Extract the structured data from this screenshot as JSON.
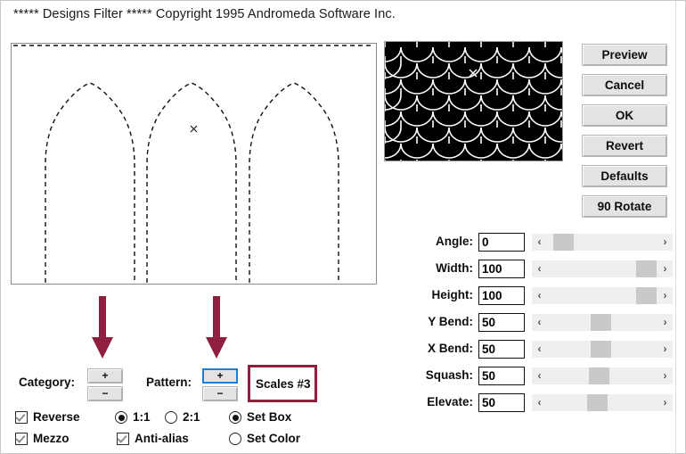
{
  "window": {
    "title": "***** Designs Filter *****  Copyright 1995 Andromeda Software Inc."
  },
  "preview_canvas": {
    "name": "shape-preview",
    "marker": "×",
    "description": "three dashed gothic arch outlines"
  },
  "pattern_thumbnail": {
    "name": "pattern-preview",
    "background_color": "#000000",
    "line_color": "#ffffff",
    "center_marker": "×"
  },
  "buttons": [
    {
      "label": "Preview",
      "name": "preview-button"
    },
    {
      "label": "Cancel",
      "name": "cancel-button"
    },
    {
      "label": "OK",
      "name": "ok-button"
    },
    {
      "label": "Revert",
      "name": "revert-button"
    },
    {
      "label": "Defaults",
      "name": "defaults-button"
    },
    {
      "label": "90 Rotate",
      "name": "rotate-90-button"
    }
  ],
  "sliders": [
    {
      "label": "Angle:",
      "value": "0",
      "percent": 4,
      "name": "angle"
    },
    {
      "label": "Width:",
      "value": "100",
      "percent": 88,
      "name": "width"
    },
    {
      "label": "Height:",
      "value": "100",
      "percent": 88,
      "name": "height"
    },
    {
      "label": "Y Bend:",
      "value": "50",
      "percent": 47,
      "name": "y-bend"
    },
    {
      "label": "X Bend:",
      "value": "50",
      "percent": 47,
      "name": "x-bend"
    },
    {
      "label": "Squash:",
      "value": "50",
      "percent": 46,
      "name": "squash"
    },
    {
      "label": "Elevate:",
      "value": "50",
      "percent": 45,
      "name": "elevate"
    }
  ],
  "slider_arrows": {
    "left": "‹",
    "right": "›"
  },
  "category": {
    "label": "Category:",
    "increment_label": "+",
    "decrement_label": "−"
  },
  "pattern": {
    "label": "Pattern:",
    "increment_label": "+",
    "decrement_label": "−",
    "selected_name": "Scales #3"
  },
  "options": {
    "reverse": {
      "label": "Reverse",
      "checked": true
    },
    "mezzo": {
      "label": "Mezzo",
      "checked": true
    },
    "ratio_1_1": {
      "label": "1:1",
      "selected": true
    },
    "ratio_2_1": {
      "label": "2:1",
      "selected": false
    },
    "anti_alias": {
      "label": "Anti-alias",
      "checked": true
    },
    "set_box": {
      "label": "Set Box",
      "selected": true
    },
    "set_color": {
      "label": "Set Color",
      "selected": false
    }
  },
  "colors": {
    "arrow": "#8e1f3f",
    "highlight_border": "#1a7fd4",
    "button_face": "#e3e3e3",
    "slider_thumb": "#c9c9c9"
  }
}
